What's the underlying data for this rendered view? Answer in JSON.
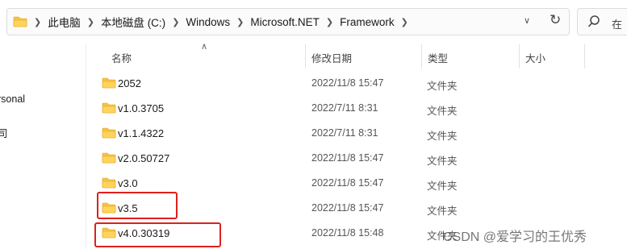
{
  "address_bar": {
    "breadcrumbs": [
      {
        "label": "此电脑"
      },
      {
        "label": "本地磁盘 (C:)"
      },
      {
        "label": "Windows"
      },
      {
        "label": "Microsoft.NET"
      },
      {
        "label": "Framework"
      }
    ]
  },
  "search": {
    "placeholder": "在"
  },
  "nav_pane": {
    "items": [
      {
        "label": "rsonal"
      },
      {
        "label": "司"
      }
    ]
  },
  "columns": {
    "name": "名称",
    "modified": "修改日期",
    "type": "类型",
    "size": "大小"
  },
  "files": [
    {
      "name": "2052",
      "modified": "2022/11/8 15:47",
      "type": "文件夹"
    },
    {
      "name": "v1.0.3705",
      "modified": "2022/7/11 8:31",
      "type": "文件夹"
    },
    {
      "name": "v1.1.4322",
      "modified": "2022/7/11 8:31",
      "type": "文件夹"
    },
    {
      "name": "v2.0.50727",
      "modified": "2022/11/8 15:47",
      "type": "文件夹"
    },
    {
      "name": "v3.0",
      "modified": "2022/11/8 15:47",
      "type": "文件夹"
    },
    {
      "name": "v3.5",
      "modified": "2022/11/8 15:47",
      "type": "文件夹",
      "highlighted": true
    },
    {
      "name": "v4.0.30319",
      "modified": "2022/11/8 15:48",
      "type": "文件夹",
      "highlighted": true
    }
  ],
  "icons": {
    "folder": "folder-icon",
    "chevron": "chevron-right-icon",
    "dropdown": "chevron-down-icon",
    "refresh": "refresh-icon",
    "search": "search-icon"
  },
  "colors": {
    "folder": "#f5c342",
    "folder_dark": "#e0a526",
    "highlight": "#e0201b"
  },
  "watermark": "CSDN @爱学习的王优秀"
}
